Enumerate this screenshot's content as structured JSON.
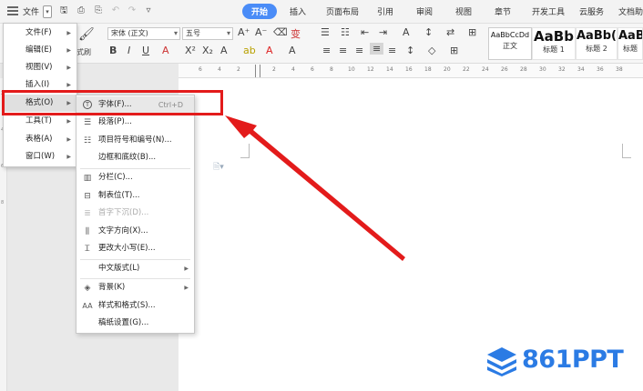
{
  "topbar": {
    "file_label": "文件",
    "tabs": [
      "开始",
      "插入",
      "页面布局",
      "引用",
      "审阅",
      "视图",
      "章节",
      "开发工具",
      "云服务",
      "文档助"
    ],
    "active_tab": "开始"
  },
  "ribbon": {
    "format_painter_label": "式刷",
    "font_name": "宋体 (正文)",
    "font_size": "五号",
    "styles": [
      {
        "sample": "AaBbCcDd",
        "name": "正文"
      },
      {
        "sample": "AaBb",
        "name": "标题 1"
      },
      {
        "sample": "AaBb(",
        "name": "标题 2"
      },
      {
        "sample": "AaBl",
        "name": "标题"
      }
    ]
  },
  "ruler": {
    "ticks": [
      "6",
      "4",
      "2",
      "2",
      "4",
      "6",
      "8",
      "10",
      "12",
      "14",
      "16",
      "18",
      "20",
      "22",
      "24",
      "26",
      "28",
      "30",
      "32",
      "34",
      "36",
      "38"
    ]
  },
  "main_menu": {
    "items": [
      {
        "label": "文件(F)"
      },
      {
        "label": "编辑(E)"
      },
      {
        "label": "视图(V)"
      },
      {
        "label": "插入(I)"
      },
      {
        "label": "格式(O)"
      },
      {
        "label": "工具(T)"
      },
      {
        "label": "表格(A)"
      },
      {
        "label": "窗口(W)"
      }
    ],
    "selected": "格式(O)"
  },
  "submenu": {
    "items": [
      {
        "label": "字体(F)...",
        "shortcut": "Ctrl+D",
        "icon": "font-icon"
      },
      {
        "label": "段落(P)...",
        "icon": "paragraph-icon"
      },
      {
        "label": "项目符号和编号(N)...",
        "icon": "list-icon"
      },
      {
        "label": "边框和底纹(B)..."
      },
      {
        "label": "分栏(C)...",
        "icon": "columns-icon"
      },
      {
        "label": "制表位(T)...",
        "icon": "tab-stop-icon"
      },
      {
        "label": "首字下沉(D)...",
        "icon": "drop-cap-icon",
        "disabled": true
      },
      {
        "label": "文字方向(X)...",
        "icon": "text-direction-icon"
      },
      {
        "label": "更改大小写(E)...",
        "icon": "change-case-icon"
      },
      {
        "label": "中文版式(L)"
      },
      {
        "label": "背景(K)",
        "icon": "background-icon"
      },
      {
        "label": "样式和格式(S)...",
        "icon": "styles-icon"
      },
      {
        "label": "稿纸设置(G)..."
      }
    ]
  },
  "logo": {
    "text": "861PPT",
    "color": "#2b7be4"
  },
  "colors": {
    "accent": "#4a8cf7",
    "highlight": "#e31b1b"
  }
}
